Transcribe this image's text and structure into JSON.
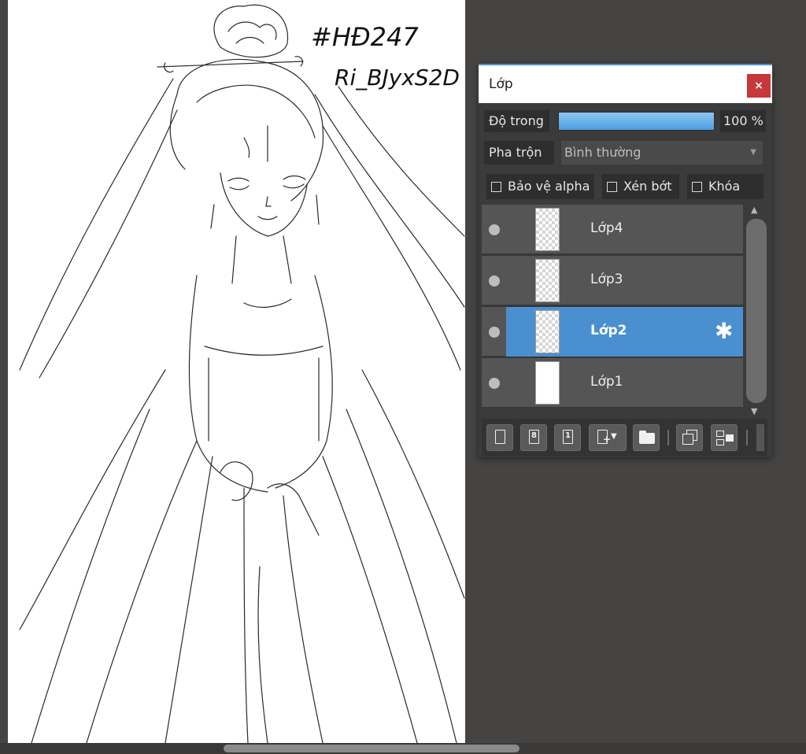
{
  "panel": {
    "title": "Lớp",
    "close_label": "×"
  },
  "opacity": {
    "label": "Độ trong",
    "value": "100 %",
    "fraction": 1.0
  },
  "blend": {
    "label": "Pha trộn",
    "selected": "Bình thường"
  },
  "checkboxes": [
    {
      "label": "Bảo vệ alpha",
      "checked": false
    },
    {
      "label": "Xén bớt",
      "checked": false
    },
    {
      "label": "Khóa",
      "checked": false
    }
  ],
  "layers": [
    {
      "name": "Lớp4",
      "selected": false
    },
    {
      "name": "Lớp3",
      "selected": false
    },
    {
      "name": "Lớp2",
      "selected": true
    },
    {
      "name": "Lớp1",
      "selected": false
    }
  ],
  "toolbar": {
    "buttons": [
      "new-layer",
      "new-layer-8bit",
      "new-layer-1bit",
      "add-layer-menu",
      "new-folder",
      "duplicate-layer",
      "merge-down"
    ],
    "num_8": "8",
    "num_1": "1"
  },
  "canvas": {
    "handwriting_line1": "#HĐ247",
    "handwriting_line2": "Ri_BJyxS2D"
  },
  "colors": {
    "accent": "#4a8fd0",
    "close": "#c7383a",
    "background": "#454443"
  },
  "icons": [
    "close-icon",
    "visibility-icon",
    "gear-icon",
    "chevron-down-icon",
    "scroll-up-icon",
    "scroll-down-icon",
    "folder-icon"
  ]
}
